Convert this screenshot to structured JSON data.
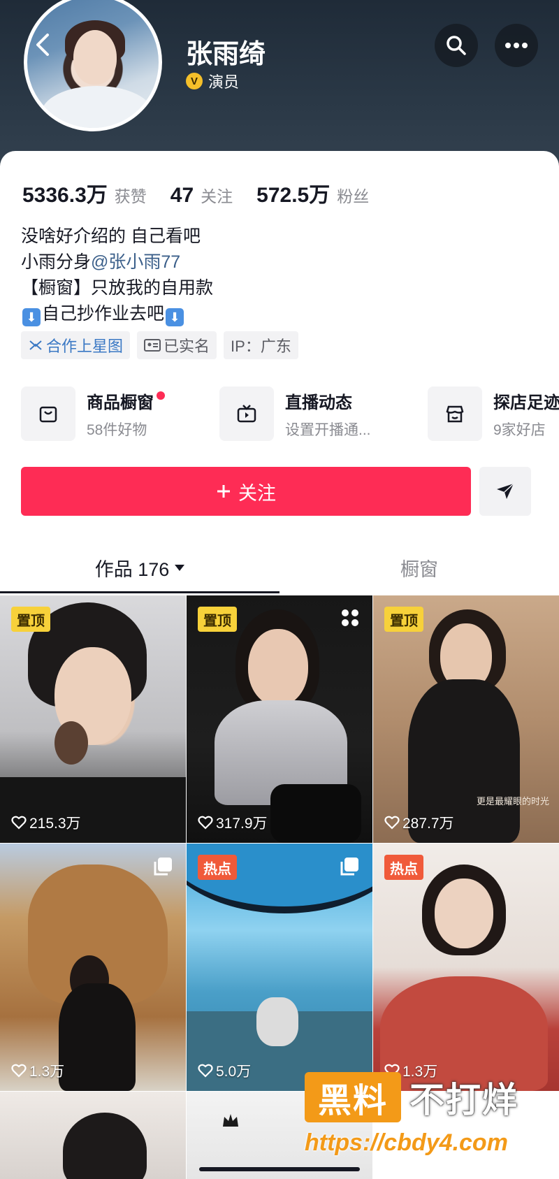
{
  "profile": {
    "name": "张雨绮",
    "verified_label": "演员",
    "verified_icon": "v-badge-icon"
  },
  "stats": [
    {
      "value": "5336.3万",
      "label": "获赞"
    },
    {
      "value": "47",
      "label": "关注"
    },
    {
      "value": "572.5万",
      "label": "粉丝"
    }
  ],
  "bio": {
    "line1": "没啥好介绍的 自己看吧",
    "line2_prefix": "小雨分身",
    "line2_mention": "@张小雨77",
    "line3": "【橱窗】只放我的自用款",
    "line4": "自己抄作业去吧"
  },
  "tags": [
    {
      "label": "合作上星图",
      "icon": "star-chart-icon"
    },
    {
      "label": "已实名",
      "icon": "id-card-icon"
    },
    {
      "label": "IP：广东"
    }
  ],
  "features": [
    {
      "title": "商品橱窗",
      "subtitle": "58件好物",
      "icon": "shopping-bag-icon"
    },
    {
      "title": "直播动态",
      "subtitle": "设置开播通...",
      "icon": "tv-icon"
    },
    {
      "title": "探店足迹",
      "subtitle": "9家好店",
      "icon": "storefront-icon"
    }
  ],
  "actions": {
    "follow_label": "关注",
    "share_icon": "share-arrow-icon"
  },
  "tabs": [
    {
      "label": "作品 176"
    },
    {
      "label": "橱窗"
    }
  ],
  "videos": [
    {
      "badge": "置顶",
      "likes": "215.3万"
    },
    {
      "badge": "置顶",
      "likes": "317.9万",
      "overlay": "更是最耀眼的时光"
    },
    {
      "badge": "置顶",
      "likes": "287.7万"
    },
    {
      "badge": "",
      "likes": "1.3万"
    },
    {
      "badge": "热点",
      "likes": "5.0万"
    },
    {
      "badge": "热点",
      "likes": "1.3万"
    }
  ],
  "watermark": {
    "box_text": "黑料",
    "right_text": "不打烊",
    "url": "https://cbdy4.com"
  },
  "colors": {
    "accent": "#fe2c55",
    "pin_badge": "#f7d13a",
    "hot_badge": "#f05a3a",
    "header_bg": "#2a3846"
  }
}
